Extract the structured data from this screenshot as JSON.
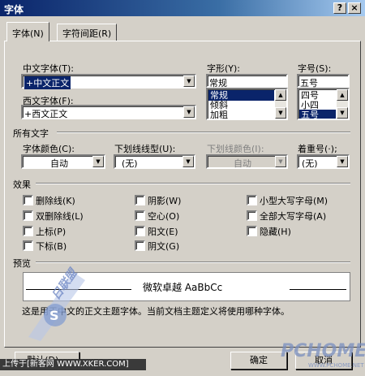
{
  "window": {
    "title": "字体",
    "help_btn": "?",
    "close_btn": "×"
  },
  "tabs": [
    {
      "label": "字体(N)"
    },
    {
      "label": "字符间距(R)"
    }
  ],
  "chinese_font": {
    "label": "中文字体(T):",
    "value": "+中文正文"
  },
  "western_font": {
    "label": "西文字体(F):",
    "value": "+西文正文"
  },
  "style": {
    "label": "字形(Y):",
    "value": "常规",
    "options": [
      "常规",
      "倾斜",
      "加粗"
    ],
    "selected": "常规"
  },
  "size": {
    "label": "字号(S):",
    "value": "五号",
    "options": [
      "四号",
      "小四",
      "五号"
    ],
    "selected": "五号"
  },
  "all_text": {
    "section_label": "所有文字",
    "font_color": {
      "label": "字体颜色(C):",
      "value": "自动"
    },
    "underline_style": {
      "label": "下划线线型(U):",
      "value": "(无)"
    },
    "underline_color": {
      "label": "下划线颜色(I):",
      "value": "自动"
    },
    "emphasis": {
      "label": "着重号(·);",
      "value": "(无)"
    }
  },
  "effects": {
    "section_label": "效果",
    "items": [
      {
        "label": "删除线(K)",
        "checked": false
      },
      {
        "label": "双删除线(L)",
        "checked": false
      },
      {
        "label": "上标(P)",
        "checked": false
      },
      {
        "label": "下标(B)",
        "checked": false
      },
      {
        "label": "阴影(W)",
        "checked": false
      },
      {
        "label": "空心(O)",
        "checked": false
      },
      {
        "label": "阳文(E)",
        "checked": false
      },
      {
        "label": "阴文(G)",
        "checked": false
      },
      {
        "label": "小型大写字母(M)",
        "checked": false
      },
      {
        "label": "全部大写字母(A)",
        "checked": false
      },
      {
        "label": "隐藏(H)",
        "checked": false
      }
    ]
  },
  "preview": {
    "section_label": "预览",
    "sample_text": "微软卓越 AaBbCc",
    "note": "这是用于中文的正文主题字体。当前文档主题定义将使用哪种字体。"
  },
  "buttons": {
    "default": "默认(D)...",
    "ok": "确定",
    "cancel": "取消"
  },
  "watermark": {
    "site_text": "PCHOME",
    "site_url": "WWW.PCHOME.NET",
    "banner": "上传于[新客网 WWW.XKER.COM]",
    "brand": "日联盟"
  }
}
